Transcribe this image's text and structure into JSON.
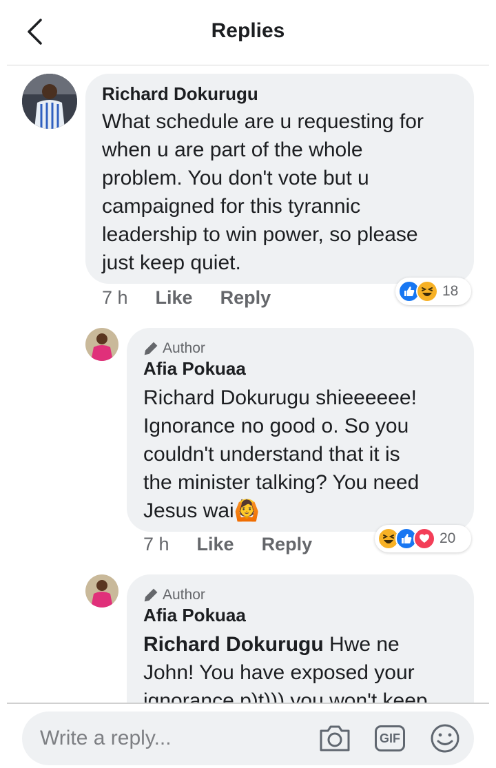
{
  "header": {
    "title": "Replies"
  },
  "comments": [
    {
      "name": "Richard Dokurugu",
      "text": "What schedule are u requesting for\nwhen u are part of the whole\nproblem. You don't vote but u\ncampaigned for this tyrannic\nleadership to win power, so please\njust keep quiet.",
      "time": "7 h",
      "like_label": "Like",
      "reply_label": "Reply",
      "reaction_count": "18"
    },
    {
      "badge": "Author",
      "name": "Afia Pokuaa",
      "text": "Richard Dokurugu shieeeeee!\nIgnorance no good o. So you\ncouldn't understand that it is\nthe minister talking? You need\nJesus wai🙆",
      "time": "7 h",
      "like_label": "Like",
      "reply_label": "Reply",
      "reaction_count": "20"
    },
    {
      "badge": "Author",
      "name": "Afia Pokuaa",
      "mention": "Richard Dokurugu",
      "text_after_mention": " Hwe ne\nJohn! You have exposed your\nignorance p)t))) you won't keep"
    }
  ],
  "composer": {
    "placeholder": "Write a reply...",
    "gif_label": "GIF"
  },
  "colors": {
    "like_blue": "#1877f2",
    "haha_yellow": "#f7b125",
    "love_red": "#f33e58",
    "bubble": "#eff1f3"
  }
}
